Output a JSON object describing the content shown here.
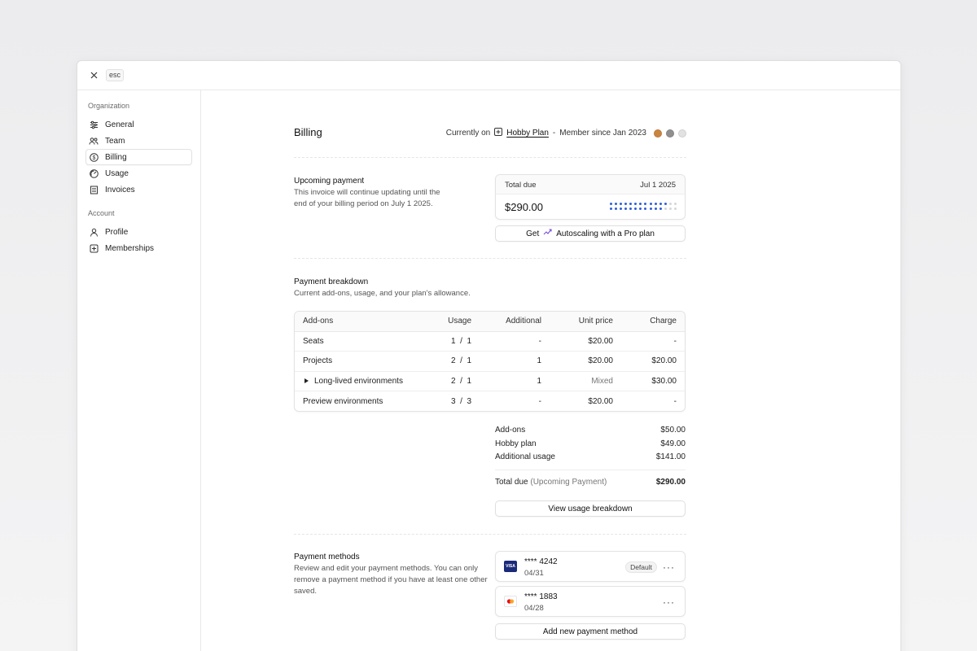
{
  "top": {
    "esc_label": "esc"
  },
  "sidebar": {
    "org_heading": "Organization",
    "org_items": [
      {
        "label": "General",
        "icon": "sliders-icon"
      },
      {
        "label": "Team",
        "icon": "users-icon"
      },
      {
        "label": "Billing",
        "icon": "dollar-icon",
        "active": true
      },
      {
        "label": "Usage",
        "icon": "gauge-icon"
      },
      {
        "label": "Invoices",
        "icon": "receipt-icon"
      }
    ],
    "account_heading": "Account",
    "account_items": [
      {
        "label": "Profile",
        "icon": "user-icon"
      },
      {
        "label": "Memberships",
        "icon": "plus-square-icon"
      }
    ]
  },
  "header": {
    "title": "Billing",
    "currently_on": "Currently on",
    "plan": "Hobby Plan",
    "separator": "-",
    "member_since": "Member since Jan 2023",
    "avatar_colors": [
      "#c9853f",
      "#8f8f8f",
      "#e2e2e2"
    ]
  },
  "upcoming": {
    "title": "Upcoming payment",
    "desc_line1": "This invoice will continue updating until the",
    "desc_line2": "end of your billing period on July 1 2025.",
    "total_due_label": "Total due",
    "date": "Jul 1 2025",
    "amount": "$290.00",
    "progress_fraction": 0.82,
    "dot_color_filled": "#2f5ed6",
    "dot_color_empty": "#d6d6d6",
    "autoscale_get": "Get",
    "autoscale_text": "Autoscaling with a Pro plan"
  },
  "breakdown": {
    "title": "Payment breakdown",
    "desc": "Current add-ons, usage, and your plan's allowance.",
    "columns": [
      "Add-ons",
      "Usage",
      "Additional",
      "Unit price",
      "Charge"
    ],
    "rows": [
      {
        "name": "Seats",
        "used": "1",
        "limit": "1",
        "additional": "-",
        "unit_price": "$20.00",
        "charge": "-"
      },
      {
        "name": "Projects",
        "used": "2",
        "limit": "1",
        "additional": "1",
        "unit_price": "$20.00",
        "charge": "$20.00"
      },
      {
        "name": "Long-lived environments",
        "used": "2",
        "limit": "1",
        "additional": "1",
        "unit_price": "Mixed",
        "charge": "$30.00",
        "expandable": true
      },
      {
        "name": "Preview environments",
        "used": "3",
        "limit": "3",
        "additional": "-",
        "unit_price": "$20.00",
        "charge": "-"
      }
    ],
    "slash": "/"
  },
  "summary": {
    "addons_label": "Add-ons",
    "addons_value": "$50.00",
    "plan_label": "Hobby plan",
    "plan_value": "$49.00",
    "usage_label": "Additional usage",
    "usage_value": "$141.00",
    "total_label": "Total due",
    "total_note": "(Upcoming Payment)",
    "total_value": "$290.00",
    "view_button": "View usage breakdown"
  },
  "payment_methods": {
    "title": "Payment methods",
    "desc_line1": "Review and edit your payment methods. You can only",
    "desc_line2": "remove a payment method if you have at least one other",
    "desc_line3": "saved.",
    "cards": [
      {
        "brand": "VISA",
        "number": "**** 4242",
        "expiry": "04/31",
        "badge": "Default"
      },
      {
        "brand": "mastercard",
        "number": "**** 1883",
        "expiry": "04/28",
        "badge": ""
      }
    ],
    "more_label": "···",
    "add_button": "Add new payment method"
  }
}
